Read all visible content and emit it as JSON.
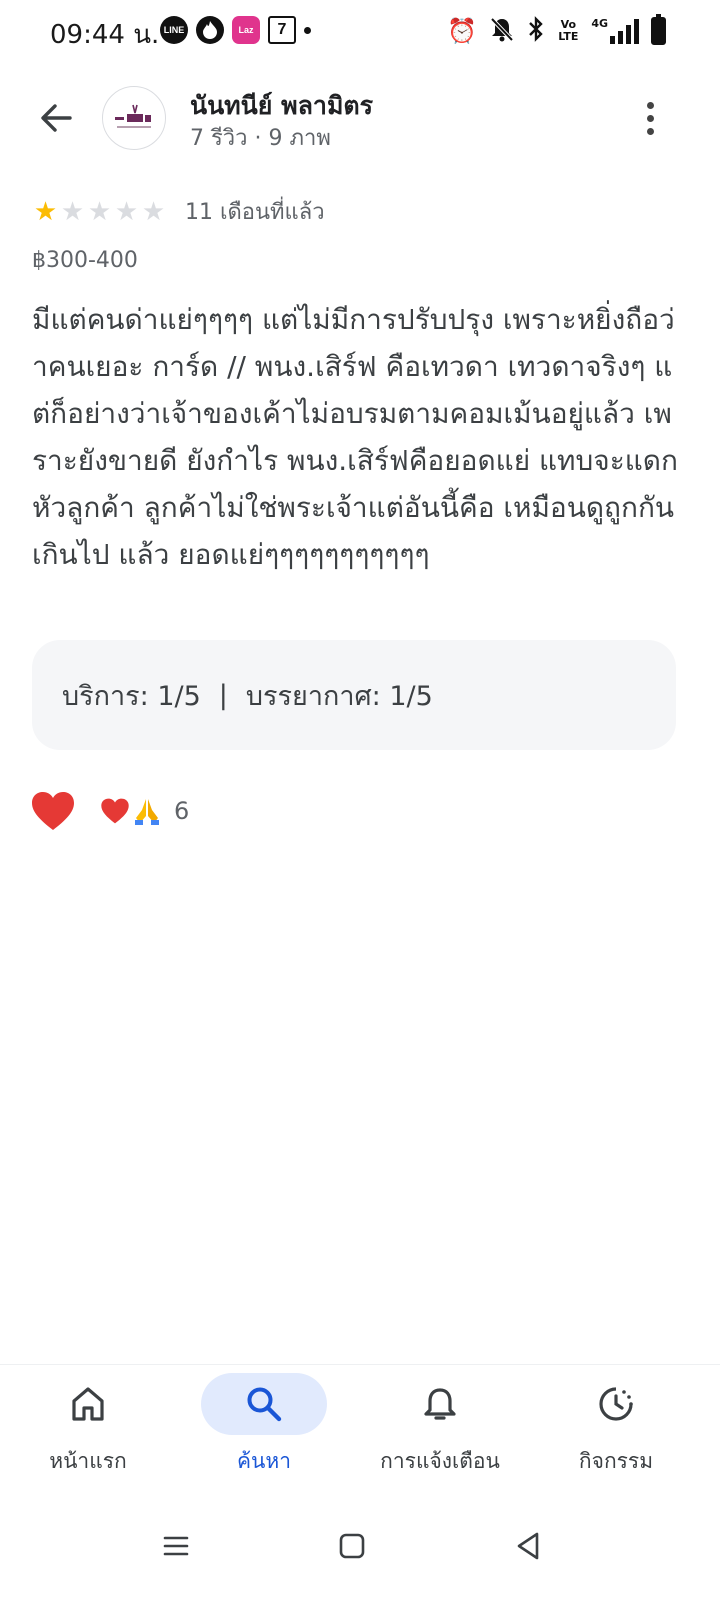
{
  "status_bar": {
    "time": "09:44 น.",
    "app_icons": [
      "line-icon",
      "tinder-icon",
      "lazada-icon",
      "seven-eleven-icon"
    ],
    "lte_label": "Vo LTE",
    "network_label": "4G"
  },
  "header": {
    "reviewer_name": "นันทนีย์ พลามิตร",
    "reviewer_meta": "7 รีวิว · 9 ภาพ"
  },
  "review": {
    "rating": 1,
    "max_rating": 5,
    "date": "11 เดือนที่แล้ว",
    "price": "฿300-400",
    "text": "มีแต่คนด่าแย่ๆๆๆๆ แต่ไม่มีการปรับปรุง เพราะหยิ่งถือว่าคนเยอะ การ์ด // พนง.เสิร์ฟ คือเทวดา เทวดาจริงๆ แต่ก็อย่างว่าเจ้าของเค้าไม่อบรมตามคอมเม้นอยู่แล้ว เพราะยังขายดี ยังกำไร พนง.เสิร์ฟคือยอดแย่ แทบจะแดกหัวลูกค้า ลูกค้าไม่ใช่พระเจ้าแต่อันนี้คือ เหมือนดูถูกกันเกินไป แล้ว ยอดแย่ๆๆๆๆๆๆๆๆๆๆๆ",
    "aspects": {
      "service": "บริการ: 1/5",
      "separator": "|",
      "atmosphere": "บรรยากาศ: 1/5"
    },
    "reactions": {
      "emojis": "❤️🙏",
      "count": "6"
    }
  },
  "bottom_nav": {
    "items": [
      {
        "label": "หน้าแรก",
        "icon": "home-icon",
        "active": false
      },
      {
        "label": "ค้นหา",
        "icon": "search-icon",
        "active": true
      },
      {
        "label": "การแจ้งเตือน",
        "icon": "bell-icon",
        "active": false
      },
      {
        "label": "กิจกรรม",
        "icon": "activity-icon",
        "active": false
      }
    ]
  },
  "colors": {
    "accent": "#1a56d6",
    "active_pill": "#e1eafd",
    "star_on": "#fbbc04",
    "star_off": "#dadce0",
    "heart": "#e53935"
  }
}
